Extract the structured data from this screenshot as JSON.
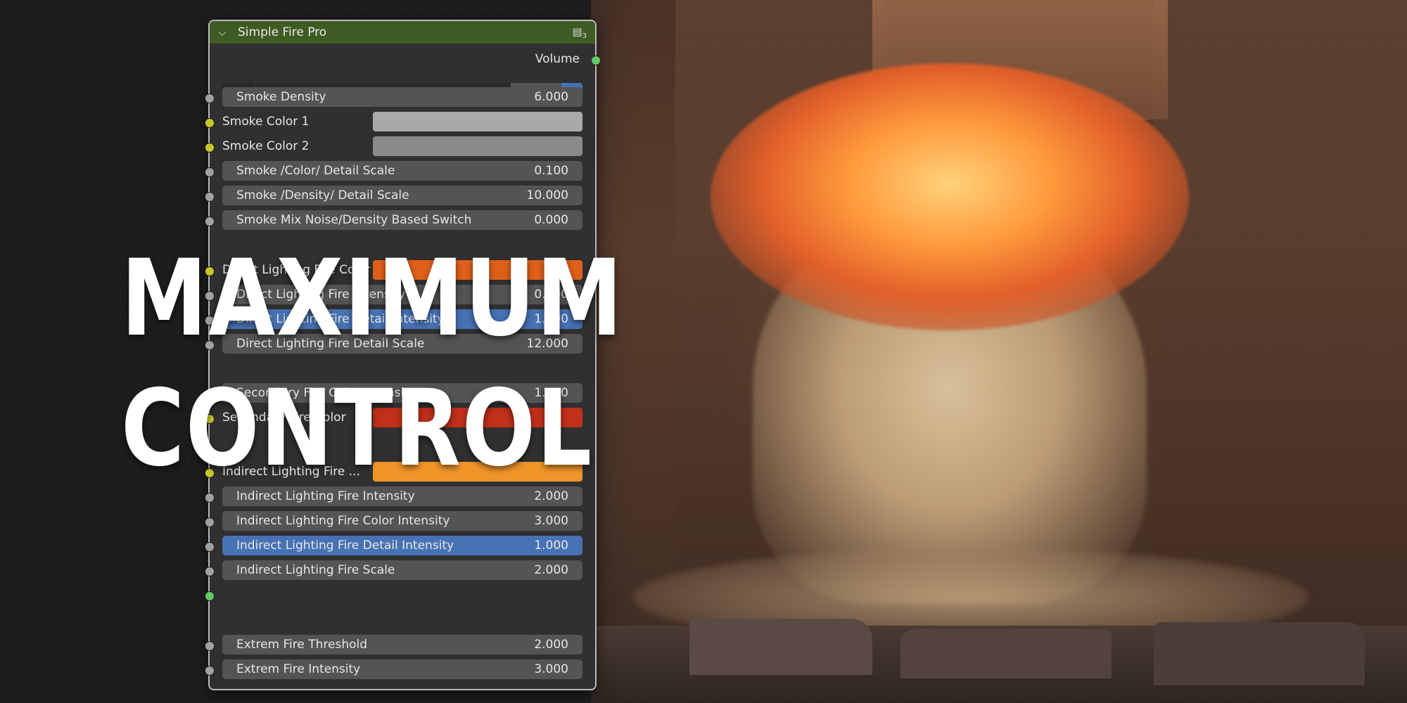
{
  "node": {
    "title": "Simple Fire Pro",
    "header_user_count": "3",
    "output_label": "Volume",
    "datablock": {
      "name": "Simple Fire Pro",
      "users": "3"
    },
    "rows": [
      {
        "label": "Smoke Density",
        "value": "6.000"
      },
      {
        "label": "Smoke Color 1",
        "color": "#a9a9a9"
      },
      {
        "label": "Smoke Color 2",
        "color": "#8a8a8a"
      },
      {
        "label": "Smoke /Color/ Detail Scale",
        "value": "0.100"
      },
      {
        "label": "Smoke /Density/ Detail Scale",
        "value": "10.000"
      },
      {
        "label": "Smoke Mix Noise/Density Based Switch",
        "value": "0.000"
      },
      {
        "label": "Direct Lighting Fire Color",
        "color": "#e0601a"
      },
      {
        "label": "Direct Lighting Fire Intensity",
        "value": "0.000"
      },
      {
        "label": "Direct Lighting Fire Detail Intensity",
        "value": "1.000"
      },
      {
        "label": "Direct Lighting Fire Detail Scale",
        "value": "12.000"
      },
      {
        "label": "Secondary Fire Color Intensity",
        "value": "1.000"
      },
      {
        "label": "Secondary Fire Color",
        "color": "#c0301a"
      },
      {
        "label": "Indirect Lighting Fire ...",
        "color": "#f0952a"
      },
      {
        "label": "Indirect Lighting Fire Intensity",
        "value": "2.000"
      },
      {
        "label": "Indirect Lighting Fire Color Intensity",
        "value": "3.000"
      },
      {
        "label": "Indirect Lighting Fire Detail Intensity",
        "value": "1.000"
      },
      {
        "label": "Indirect Lighting Fire Scale",
        "value": "2.000"
      },
      {
        "label": "Extrem Fire Threshold",
        "value": "2.000"
      },
      {
        "label": "Extrem Fire Intensity",
        "value": "3.000"
      }
    ]
  },
  "overlay": {
    "line1": "MAXIMUM",
    "line2": "CONTROL"
  },
  "icons": [
    "chevron-down-icon",
    "node-users-icon",
    "material-sphere-icon",
    "fake-user-shield-icon"
  ]
}
